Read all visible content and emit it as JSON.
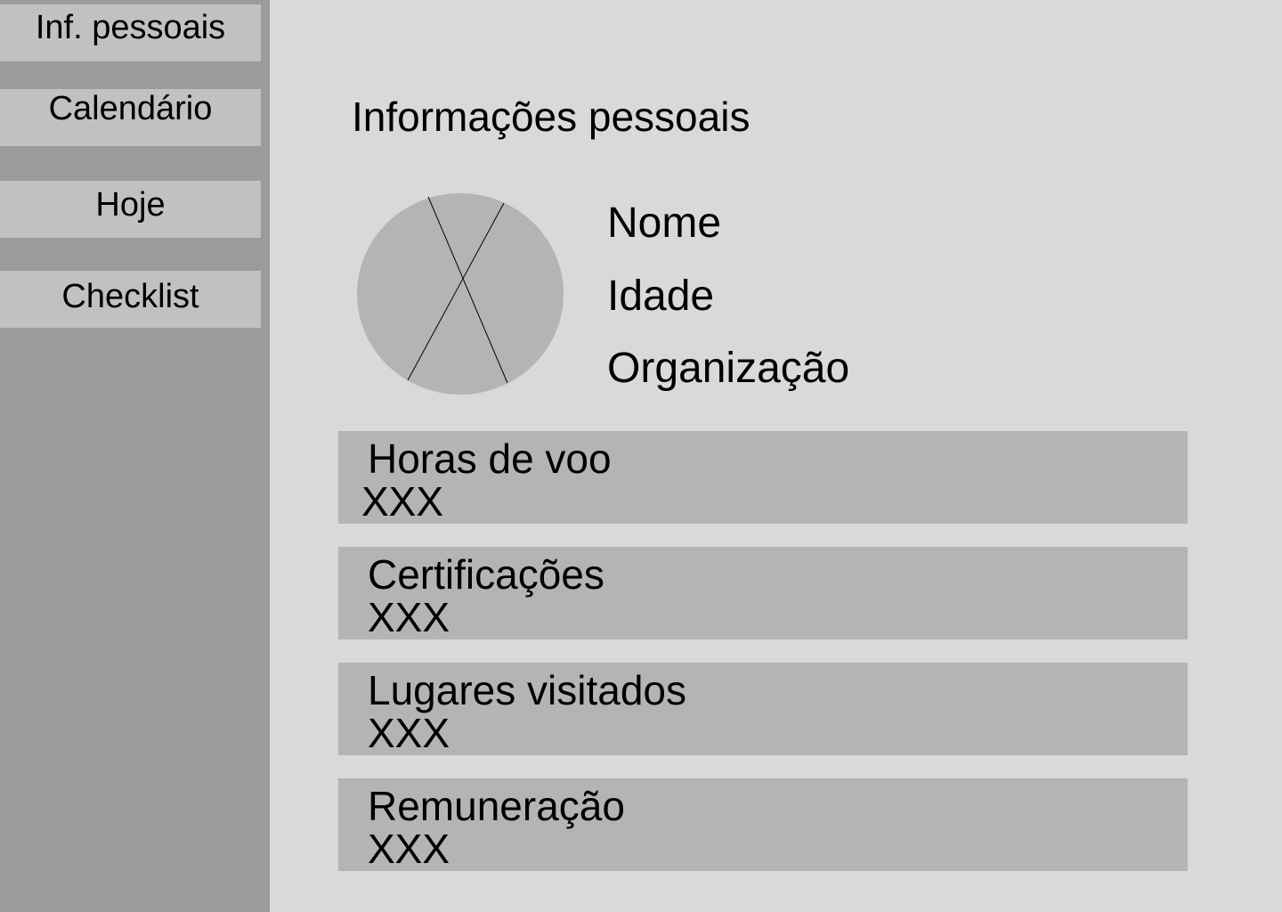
{
  "sidebar": {
    "items": [
      {
        "label": "Inf. pessoais"
      },
      {
        "label": "Calendário"
      },
      {
        "label": "Hoje"
      },
      {
        "label": "Checklist"
      }
    ]
  },
  "main": {
    "title": "Informações pessoais",
    "profile": {
      "name_label": "Nome",
      "age_label": "Idade",
      "organization_label": "Organização"
    },
    "cards": [
      {
        "label": "Horas de voo",
        "value": "XXX"
      },
      {
        "label": "Certificações",
        "value": "XXX"
      },
      {
        "label": "Lugares visitados",
        "value": "XXX"
      },
      {
        "label": "Remuneração",
        "value": "XXX"
      }
    ]
  },
  "colors": {
    "background": "#d9d9d9",
    "sidebar": "#9c9a9b",
    "nav_item": "#c1c1c1",
    "card": "#b4b4b4",
    "avatar": "#b4b4b4"
  }
}
